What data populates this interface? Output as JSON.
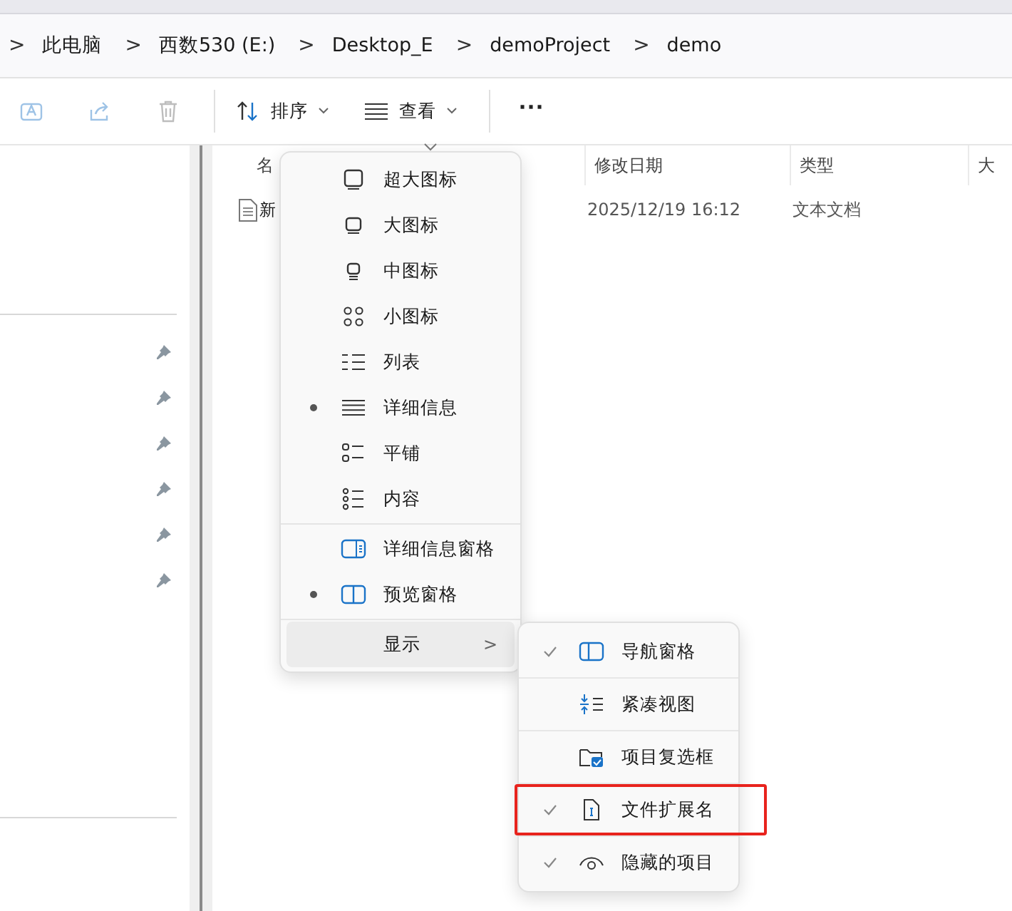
{
  "breadcrumb": {
    "lead": ">",
    "items": [
      {
        "label": "此电脑"
      },
      {
        "label": "西数530 (E:)"
      },
      {
        "label": "Desktop_E"
      },
      {
        "label": "demoProject"
      },
      {
        "label": "demo"
      }
    ],
    "separator": ">"
  },
  "toolbar": {
    "sort": {
      "label": "排序"
    },
    "view": {
      "label": "查看"
    },
    "more": "···"
  },
  "columns": [
    {
      "label": "名"
    },
    {
      "label": "修改日期"
    },
    {
      "label": "类型"
    },
    {
      "label": "大"
    }
  ],
  "files": [
    {
      "name": "新",
      "modified": "2025/12/19 16:12",
      "type": "文本文档"
    }
  ],
  "sidebar": {
    "pinned_count_items": [
      {
        "pinned": true
      },
      {
        "pinned": true
      },
      {
        "pinned": true
      },
      {
        "pinned": true
      },
      {
        "pinned": true
      },
      {
        "pinned": true
      }
    ]
  },
  "view_menu": {
    "groups": [
      [
        {
          "label": "超大图标",
          "selected": false
        },
        {
          "label": "大图标",
          "selected": false
        },
        {
          "label": "中图标",
          "selected": false
        },
        {
          "label": "小图标",
          "selected": false
        },
        {
          "label": "列表",
          "selected": false
        },
        {
          "label": "详细信息",
          "selected": true
        },
        {
          "label": "平铺",
          "selected": false
        },
        {
          "label": "内容",
          "selected": false
        }
      ],
      [
        {
          "label": "详细信息窗格",
          "selected": false
        },
        {
          "label": "预览窗格",
          "selected": true
        }
      ]
    ],
    "show": {
      "label": "显示",
      "arrow": ">",
      "expanded": true
    }
  },
  "show_menu": [
    {
      "label": "导航窗格",
      "checked": true,
      "highlighted": false
    },
    {
      "label": "紧凑视图",
      "checked": false,
      "highlighted": false
    },
    {
      "label": "项目复选框",
      "checked": false,
      "highlighted": false
    },
    {
      "label": "文件扩展名",
      "checked": true,
      "highlighted": true
    },
    {
      "label": "隐藏的项目",
      "checked": true,
      "highlighted": false
    }
  ]
}
